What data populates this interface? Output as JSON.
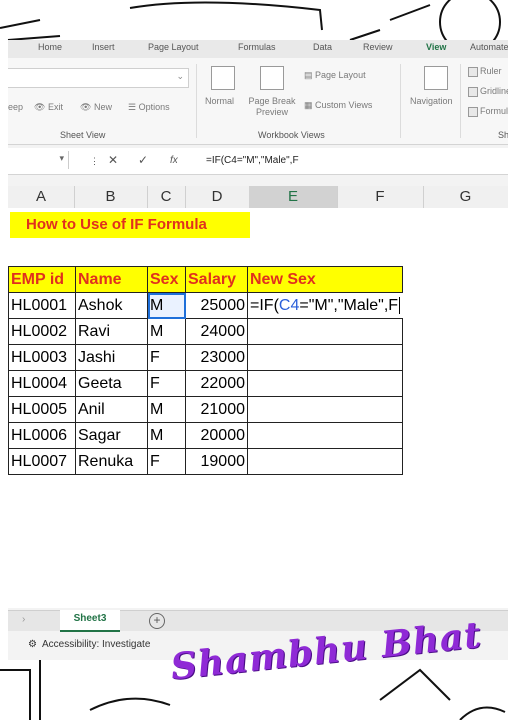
{
  "ribbon": {
    "tabs": [
      "Home",
      "Insert",
      "Page Layout",
      "Formulas",
      "Data",
      "Review",
      "View",
      "Automate"
    ],
    "sheet_view": {
      "keep_label": "Keep",
      "exit_label": "Exit",
      "new_label": "New",
      "options_label": "Options",
      "group_label": "Sheet View"
    },
    "workbook_views": {
      "normal_label": "Normal",
      "page_break_label": "Page Break Preview",
      "page_layout_label": "Page Layout",
      "custom_views_label": "Custom Views",
      "group_label": "Workbook Views"
    },
    "show": {
      "navigation_label": "Navigation",
      "ruler_label": "Ruler",
      "gridlines_label": "Gridlines",
      "formula_label": "Formula",
      "group_label": "Sh"
    }
  },
  "formula_bar": {
    "cancel": "✕",
    "enter": "✓",
    "fx": "fx",
    "content": "=IF(C4=\"M\",\"Male\",F"
  },
  "columns": [
    "A",
    "B",
    "C",
    "D",
    "E",
    "F",
    "G"
  ],
  "sheet": {
    "title": "How to Use of IF Formula",
    "headers": [
      "EMP id",
      "Name",
      "Sex",
      "Salary",
      "New Sex"
    ],
    "rows": [
      {
        "id": "HL0001",
        "name": "Ashok",
        "sex": "M",
        "salary": "25000"
      },
      {
        "id": "HL0002",
        "name": "Ravi",
        "sex": "M",
        "salary": "24000"
      },
      {
        "id": "HL0003",
        "name": "Jashi",
        "sex": "F",
        "salary": "23000"
      },
      {
        "id": "HL0004",
        "name": "Geeta",
        "sex": "F",
        "salary": "22000"
      },
      {
        "id": "HL0005",
        "name": "Anil",
        "sex": "M",
        "salary": "21000"
      },
      {
        "id": "HL0006",
        "name": "Sagar",
        "sex": "M",
        "salary": "20000"
      },
      {
        "id": "HL0007",
        "name": "Renuka",
        "sex": "F",
        "salary": "19000"
      }
    ],
    "editing_cell": {
      "prefix": "=IF(",
      "ref": "C4",
      "suffix": "=\"M\",\"Male\",F"
    }
  },
  "sheet_tab": "Sheet3",
  "add_sheet": "+",
  "status": {
    "accessibility": "Accessibility: Investigate"
  },
  "watermark": "Shambhu Bhat",
  "colors": {
    "excel_green": "#217346",
    "header_yellow": "#ffff00",
    "header_red": "#e0301e",
    "reference_blue": "#2b5fd9"
  }
}
